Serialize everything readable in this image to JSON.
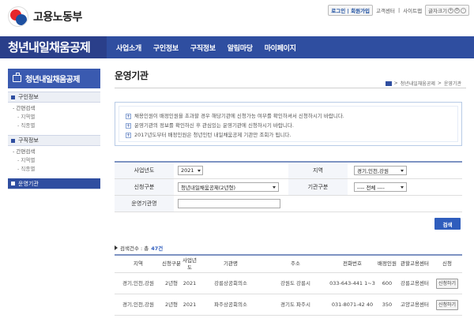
{
  "header": {
    "logo_text": "고용노동부",
    "login": "로그인",
    "join": "회원가입",
    "service_center": "고객센터",
    "sitemap": "사이트맵",
    "font_size": "글자크기",
    "zoom_in": "+",
    "zoom_reset": "0",
    "zoom_out": "-"
  },
  "nav": {
    "brand": "청년내일채움공제",
    "items": [
      "사업소개",
      "구인정보",
      "구직정보",
      "알림마당",
      "마이페이지"
    ]
  },
  "sidebar": {
    "title": "청년내일채움공제",
    "sections": [
      {
        "label": "구인정보",
        "items": [
          "간편검색",
          "지역별",
          "직종별"
        ]
      },
      {
        "label": "구직정보",
        "items": [
          "간편검색",
          "지역별",
          "직종별"
        ]
      },
      {
        "label": "운영기관",
        "items": []
      }
    ]
  },
  "page": {
    "title": "운영기관",
    "breadcrumb": [
      "청년내일채움공제",
      "운영기관"
    ]
  },
  "notice": [
    "채용인원이 배정인원을 초과할 경우 해당기관에 신청가능 여부를 확인하셔서 신청하시기 바랍니다.",
    "운영기관의 정보를 확인하신 후 관심있는 운영기관에 신청하시기 바랍니다.",
    "2017년도부터 배정인원은 청년인턴 내일채움공제 기관만 조회가 됩니다."
  ],
  "form": {
    "year_label": "사업년도",
    "year_value": "2021",
    "region_label": "지역",
    "region_value": "경기,인천,강원",
    "type_label": "신청구분",
    "type_value": "청년내일채움공제(2년형)",
    "org_type_label": "기관구분",
    "org_type_value": "---- 전체 ----",
    "org_name_label": "운영기관명",
    "org_name_value": "",
    "search_button": "검색"
  },
  "results": {
    "count_label": "검색건수 : 총",
    "count_value": "47건",
    "columns": [
      "지역",
      "신청구분",
      "사업년도",
      "기관명",
      "주소",
      "전화번호",
      "배정인원",
      "관할고용센터",
      "신청"
    ],
    "rows": [
      {
        "region": "경기,인천,강원",
        "type": "2년형",
        "year": "2021",
        "name": "강릉상공회의소",
        "address": "강원도 강릉시",
        "phone": "033-643-441 1~3",
        "quota": "600",
        "center": "강릉고용센터",
        "apply": "신청하기"
      },
      {
        "region": "경기,인천,강원",
        "type": "2년형",
        "year": "2021",
        "name": "파주상공회의소",
        "address": "경기도 파주시",
        "phone": "031-8071-42 40",
        "quota": "350",
        "center": "고양고용센터",
        "apply": "신청하기"
      }
    ]
  },
  "colors": {
    "brand_blue": "#2f4ea0",
    "accent_blue": "#2f5dbd"
  }
}
